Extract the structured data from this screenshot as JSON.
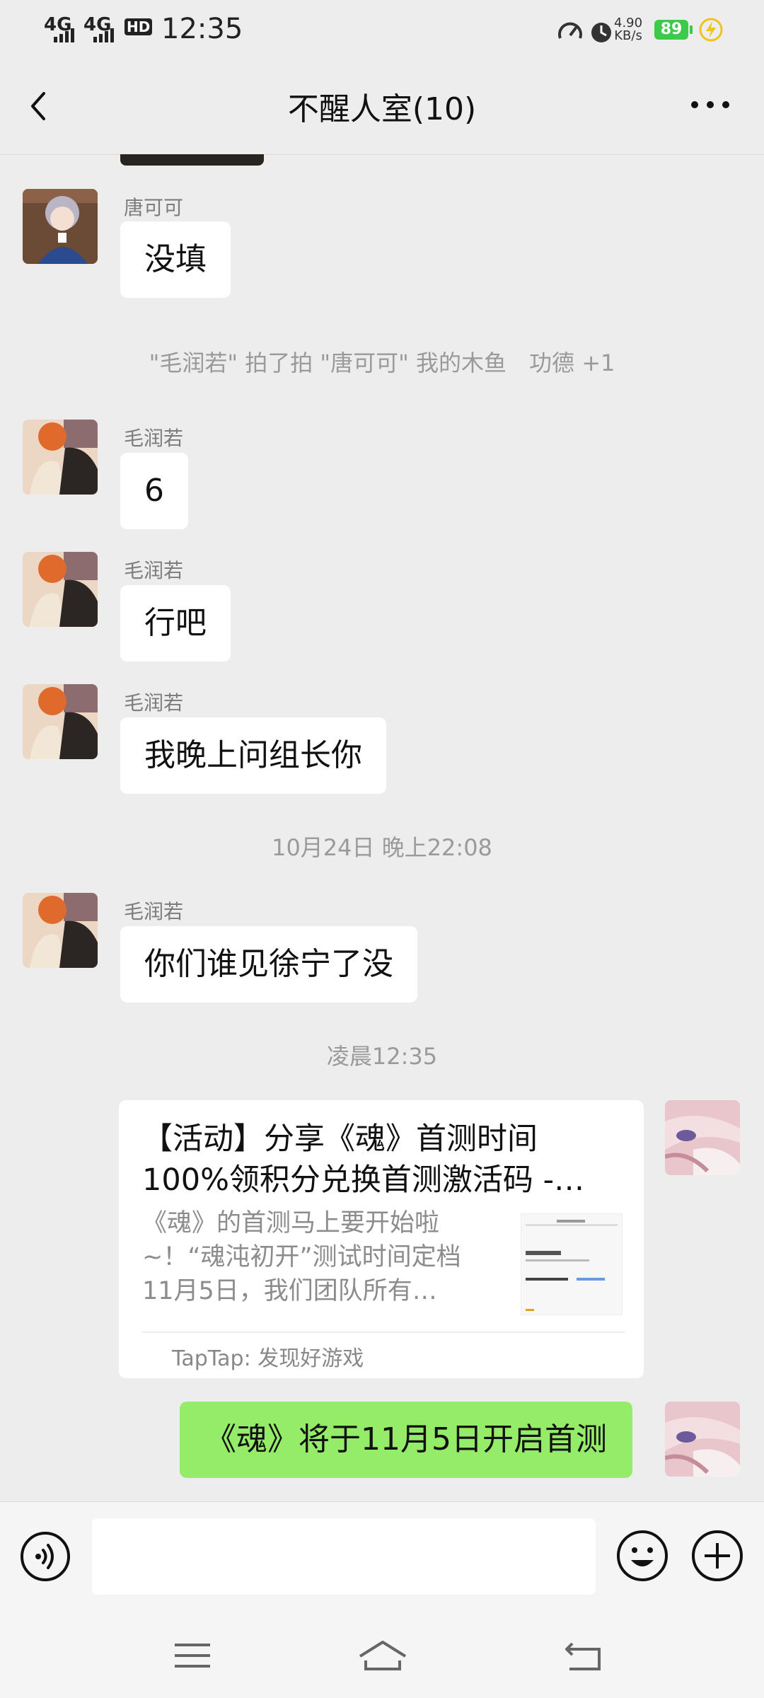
{
  "status_bar": {
    "sig1": "4G",
    "sig2": "4G",
    "hd": "HD",
    "time": "12:35",
    "speed_value": "4.90",
    "speed_unit": "KB/s",
    "battery": "89"
  },
  "header": {
    "title": "不醒人室(10)"
  },
  "messages": [
    {
      "sender": "唐可可",
      "text": "没填"
    },
    {
      "system": "\"毛润若\" 拍了拍 \"唐可可\" 我的木鱼　功德 +1"
    },
    {
      "sender": "毛润若",
      "text": "6"
    },
    {
      "sender": "毛润若",
      "text": "行吧"
    },
    {
      "sender": "毛润若",
      "text": "我晚上问组长你"
    },
    {
      "timestamp": "10月24日 晚上22:08"
    },
    {
      "sender": "毛润若",
      "text": "你们谁见徐宁了没"
    },
    {
      "timestamp": "凌晨12:35"
    },
    {
      "card": {
        "title": "【活动】分享《魂》首测时间100%领积分兑换首测激活码 -…",
        "desc": "《魂》的首测马上要开始啦~！“魂沌初开”测试时间定档11月5日，我们团队所有…",
        "source": "TapTap: 发现好游戏"
      }
    },
    {
      "self_text": "《魂》将于11月5日开启首测"
    }
  ],
  "colors": {
    "self_bubble": "#95ec69",
    "battery": "#3ec94b"
  }
}
